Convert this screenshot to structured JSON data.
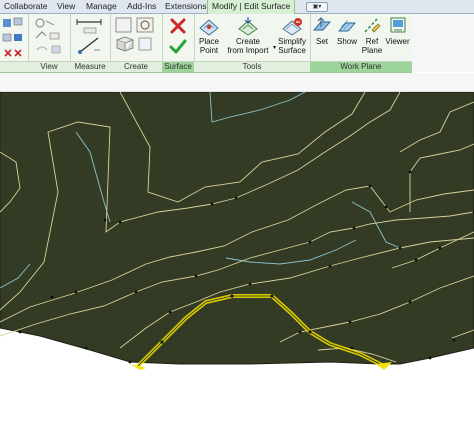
{
  "tabs": [
    "Collaborate",
    "View",
    "Manage",
    "Add-Ins",
    "Extensions",
    "Modify | Edit Surface"
  ],
  "tab_menu_icon": "panel-toggle-icon",
  "panels": {
    "view": "View",
    "measure": "Measure",
    "create": "Create",
    "surface": "Surface",
    "tools": "Tools",
    "work_plane": "Work Plane"
  },
  "buttons": {
    "place_point": [
      "Place",
      "Point"
    ],
    "create_from_import": [
      "Create",
      "from Import"
    ],
    "simplify_surface": [
      "Simplify",
      "Surface"
    ],
    "set": "Set",
    "show": "Show",
    "ref_plane": [
      "Ref",
      "Plane"
    ],
    "viewer": "Viewer"
  },
  "icons": [
    "cancel-icon",
    "finish-icon",
    "place-point-icon",
    "create-from-import-icon",
    "simplify-surface-icon",
    "set-workplane-icon",
    "show-workplane-icon",
    "ref-plane-icon",
    "viewer-icon"
  ],
  "colors": {
    "terrain": "#343b24",
    "contour_major": "#d8d29a",
    "contour_minor": "#8cc3cf",
    "selection": "#f3e400",
    "ribbon_accent": "#9cd49a"
  }
}
